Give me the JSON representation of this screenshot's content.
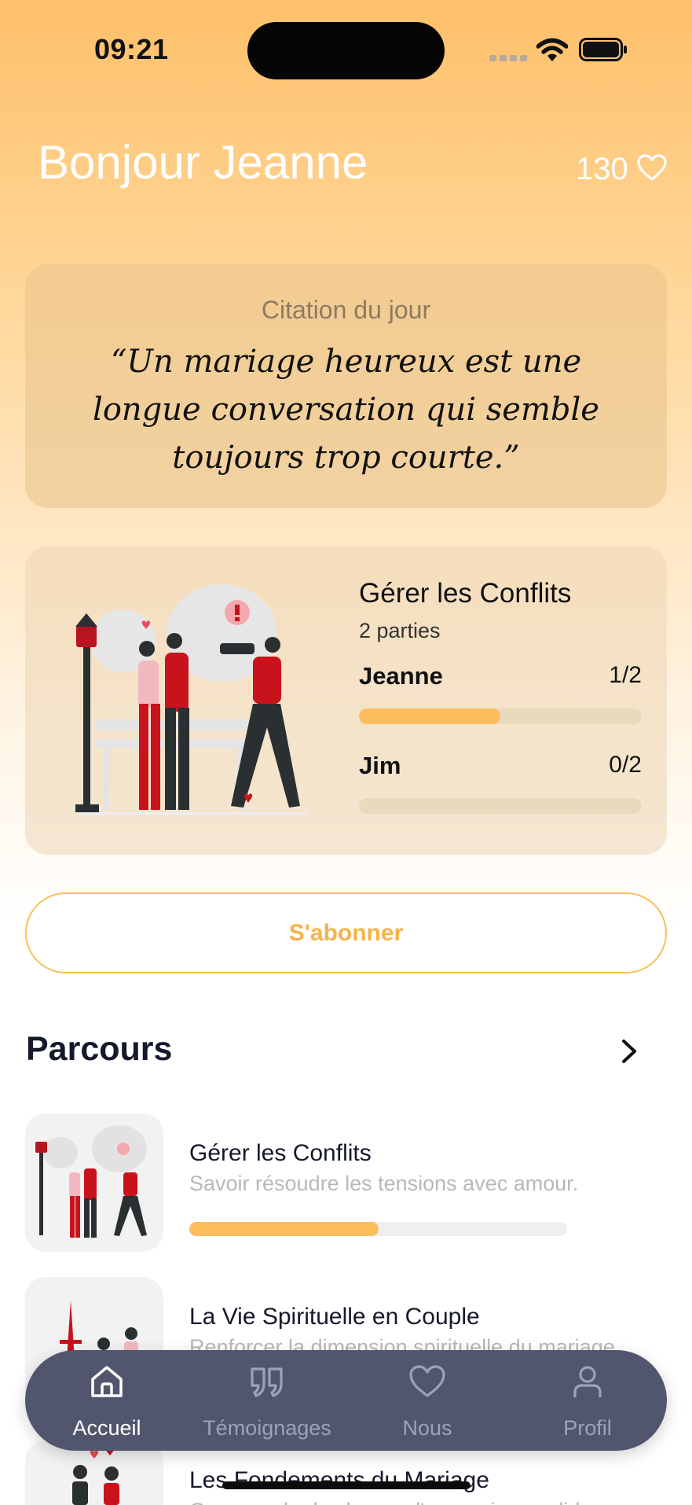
{
  "status_bar": {
    "time": "09:21"
  },
  "header": {
    "greeting": "Bonjour Jeanne",
    "hearts": "130"
  },
  "quote": {
    "title": "Citation du jour",
    "text": "“Un mariage heureux est une longue conversation qui semble toujours trop courte.”"
  },
  "current_course": {
    "title": "Gérer les Conflits",
    "parts": "2 parties",
    "participants": [
      {
        "name": "Jeanne",
        "score": "1/2",
        "progress": 0.5
      },
      {
        "name": "Jim",
        "score": "0/2",
        "progress": 0.0
      }
    ]
  },
  "subscribe": {
    "label": "S'abonner"
  },
  "courses_section": {
    "title": "Parcours",
    "items": [
      {
        "title": "Gérer les Conflits",
        "subtitle": "Savoir résoudre les tensions avec amour.",
        "progress": 0.5
      },
      {
        "title": "La Vie Spirituelle en Couple",
        "subtitle": "Renforcer la dimension spirituelle du mariage.",
        "progress": 0.0
      },
      {
        "title": "Les Fondements du Mariage",
        "subtitle": "Comprendre les bases d'un mariage solide",
        "progress": 0.0
      }
    ]
  },
  "tabbar": {
    "items": [
      {
        "label": "Accueil",
        "icon": "home-icon",
        "active": true
      },
      {
        "label": "Témoignages",
        "icon": "quote-icon",
        "active": false
      },
      {
        "label": "Nous",
        "icon": "heart-icon",
        "active": false
      },
      {
        "label": "Profil",
        "icon": "user-icon",
        "active": false
      }
    ]
  },
  "colors": {
    "accent": "#fcbd5d",
    "tabbar": "#51566e",
    "ink": "#15192b"
  }
}
